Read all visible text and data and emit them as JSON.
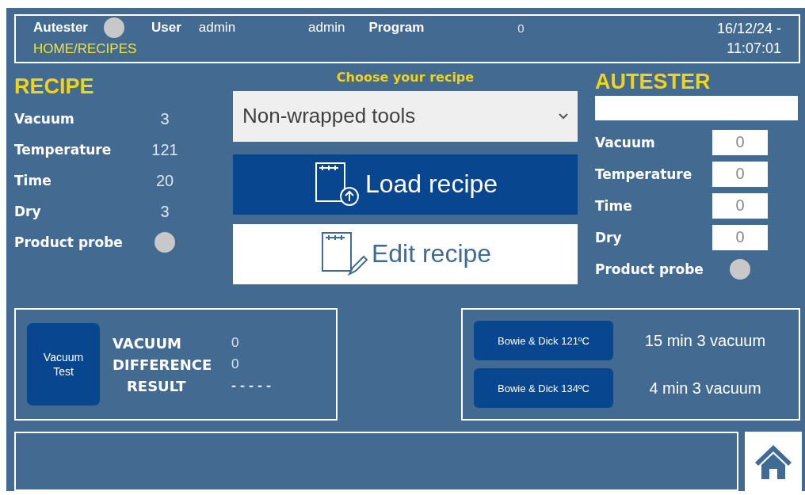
{
  "header": {
    "device_label": "Autester",
    "device_lamp_on": false,
    "user_label": "User",
    "user_value": "admin",
    "user_name": "admin",
    "program_label": "Program",
    "program_value": "0",
    "date": "16/12/24 -",
    "time": "11:07:01",
    "breadcrumb": "HOME/RECIPES"
  },
  "recipe": {
    "title": "RECIPE",
    "rows": [
      {
        "label": "Vacuum",
        "value": "3"
      },
      {
        "label": "Temperature",
        "value": "121"
      },
      {
        "label": "Time",
        "value": "20"
      },
      {
        "label": "Dry",
        "value": "3"
      }
    ],
    "probe": {
      "label": "Product probe",
      "on": false
    }
  },
  "chooser": {
    "title": "Choose your recipe",
    "selected_recipe": "Non-wrapped tools",
    "buttons": [
      {
        "label": "Load recipe",
        "kind": "load"
      },
      {
        "label": "Edit recipe",
        "kind": "edit"
      }
    ]
  },
  "autester": {
    "title": "AUTESTER",
    "rows": [
      {
        "label": "Vacuum",
        "value": "0"
      },
      {
        "label": "Temperature",
        "value": "0"
      },
      {
        "label": "Time",
        "value": "0"
      },
      {
        "label": "Dry",
        "value": "0"
      }
    ],
    "probe": {
      "label": "Product probe",
      "on": false
    }
  },
  "vacuum_test": {
    "button": [
      "Vacuum",
      "Test"
    ],
    "rows": [
      {
        "label": "VACUUM",
        "value": "0"
      },
      {
        "label": "DIFFERENCE",
        "value": "0"
      },
      {
        "label": "RESULT",
        "value": "- - - - -"
      }
    ]
  },
  "bowie_dick": [
    {
      "button": "Bowie & Dick 121ºC",
      "description": "15 min 3 vacuum"
    },
    {
      "button": "Bowie & Dick 134ºC",
      "description": "4 min 3 vacuum"
    }
  ]
}
